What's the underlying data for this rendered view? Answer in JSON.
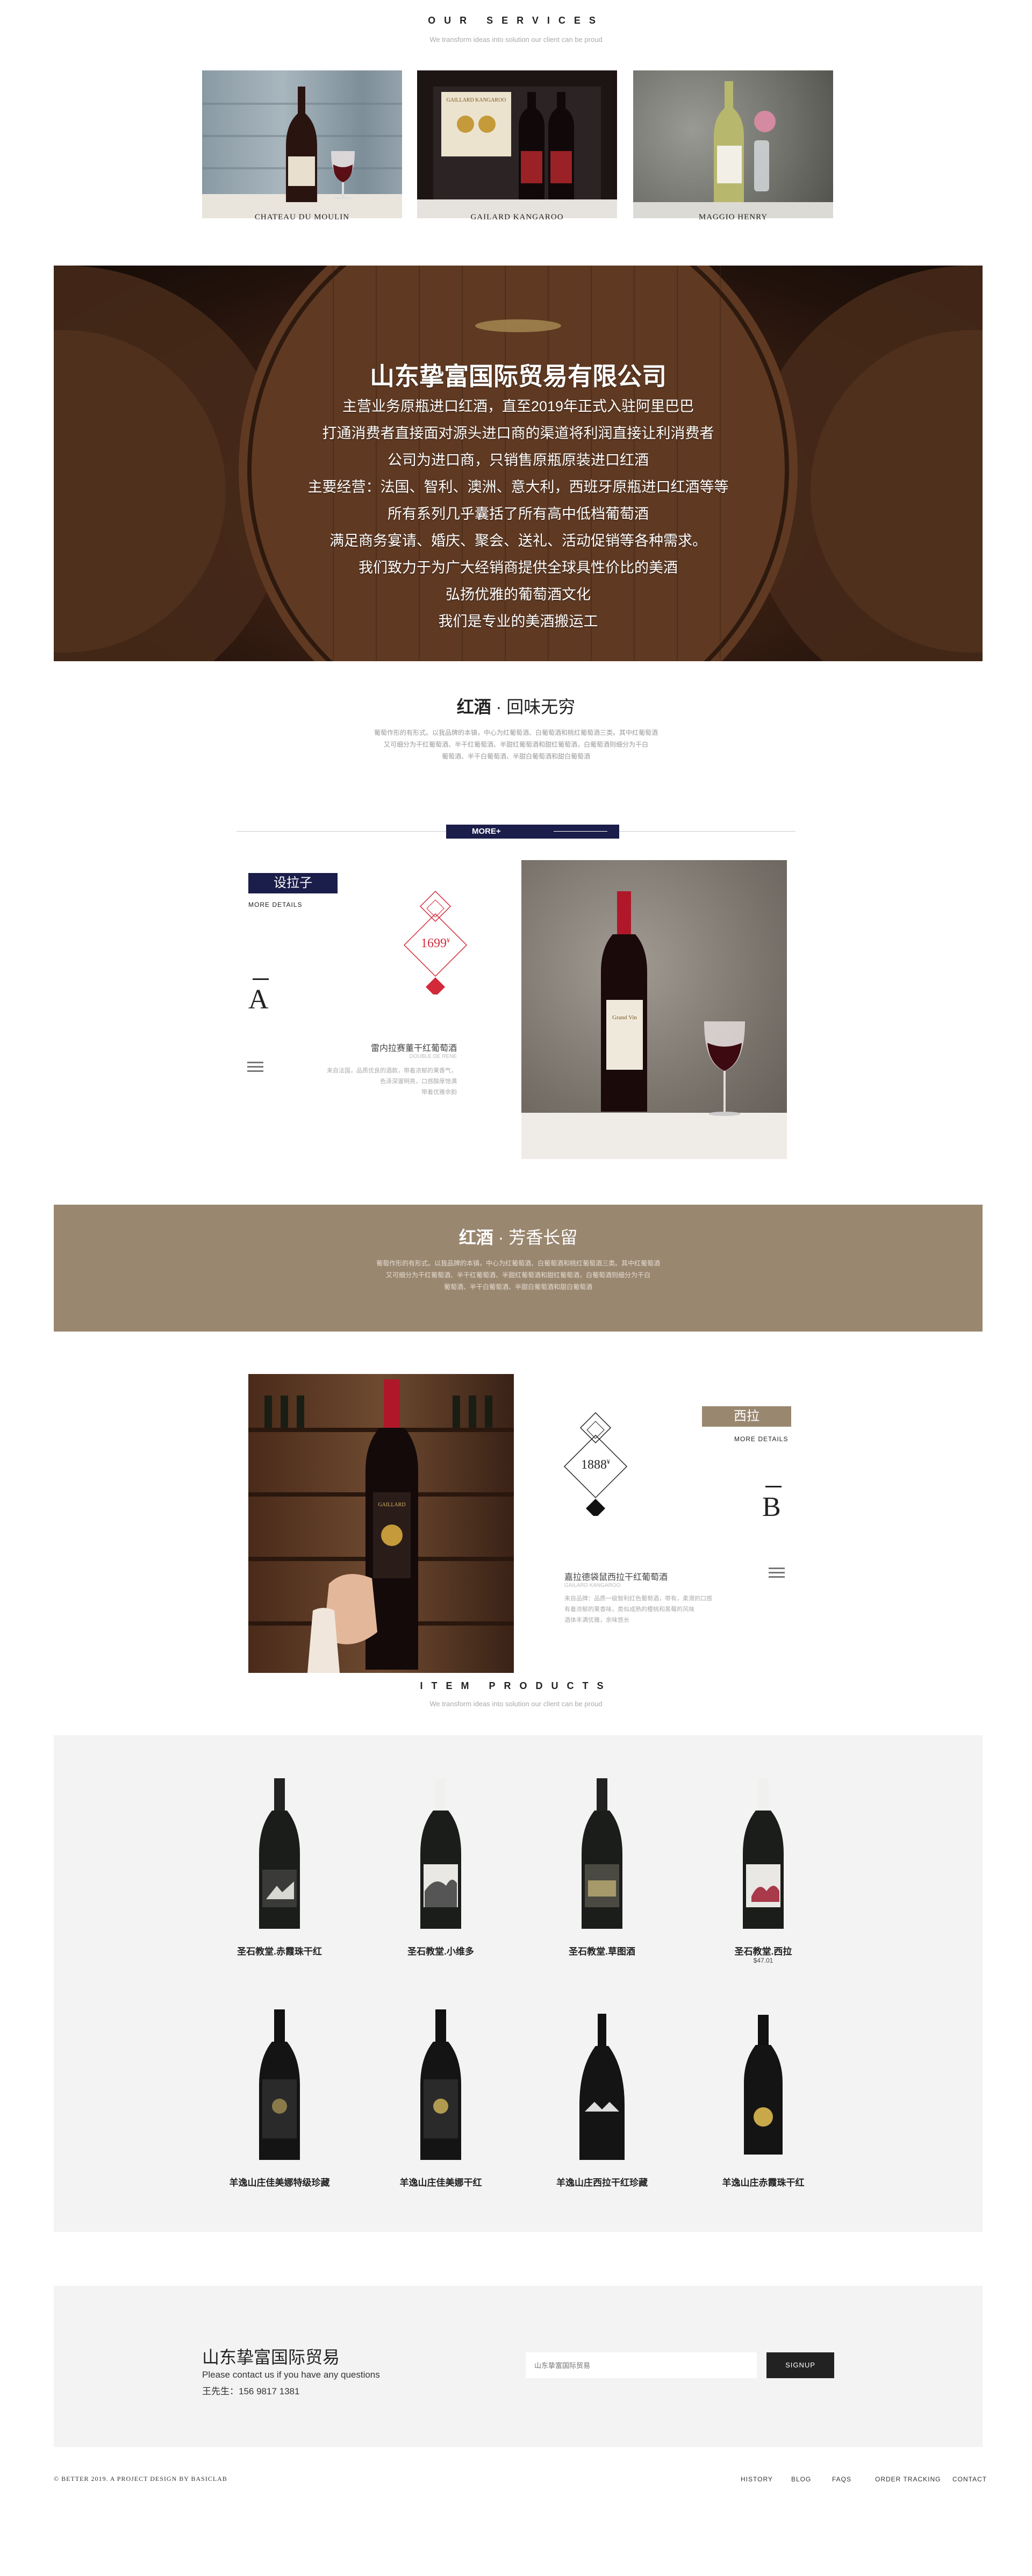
{
  "services": {
    "title": "OUR SERVICES",
    "subtitle": "We transform ideas into solution our client can be proud",
    "cards": [
      {
        "caption": "CHATEAU DU MOULIN"
      },
      {
        "caption": "GAILARD KANGAROO"
      },
      {
        "caption": "MAGGIO HENRY"
      }
    ]
  },
  "hero": {
    "lines": [
      "山东挚富国际贸易有限公司",
      "主营业务原瓶进口红酒，直至2019年正式入驻阿里巴巴",
      "打通消费者直接面对源头进口商的渠道将利润直接让利消费者",
      "公司为进口商，只销售原瓶原装进口红酒",
      "主要经营：法国、智利、澳洲、意大利，西班牙原瓶进口红酒等等",
      "所有系列几乎囊括了所有高中低档葡萄酒",
      "满足商务宴请、婚庆、聚会、送礼、活动促销等各种需求。",
      "我们致力于为广大经销商提供全球具性价比的美酒",
      "弘扬优雅的葡萄酒文化",
      "我们是专业的美酒搬运工"
    ]
  },
  "section1": {
    "title_bold": "红酒",
    "title_rest": " · 回味无穷",
    "desc": [
      "葡萄作形的有形式。以我品牌的本镇，中心为红葡萄酒、白葡萄酒和桃红葡萄酒三类。其中红葡萄酒",
      "又可细分为干红葡萄酒、半干红葡萄酒、半甜红葡萄酒和甜红葡萄酒，白葡萄酒则细分为干白",
      "葡萄酒、半干白葡萄酒、半甜白葡萄酒和甜白葡萄酒"
    ],
    "more_label": "MORE+"
  },
  "product_a": {
    "tag": "设拉子",
    "more": "MORE DETAILS",
    "price": "1699",
    "currency": "¥",
    "letter": "A",
    "name": "雷内拉赛董干红葡萄酒",
    "sub": "DOUBLE DE RENE",
    "desc": [
      "来自法国，品质优良的酒款，带着浓郁的果香气，",
      "色泽深邃明亮，口感醇厚饱满",
      "带着优雅余韵"
    ]
  },
  "section2": {
    "title_bold": "红酒",
    "title_rest": " · 芳香长留",
    "desc": [
      "葡萄作形的有形式。以我品牌的本镇，中心为红葡萄酒、白葡萄酒和桃红葡萄酒三类。其中红葡萄酒",
      "又可细分为干红葡萄酒、半干红葡萄酒、半甜红葡萄酒和甜红葡萄酒，白葡萄酒则细分为干白",
      "葡萄酒、半干白葡萄酒、半甜白葡萄酒和甜白葡萄酒"
    ]
  },
  "product_b": {
    "tag": "西拉",
    "more": "MORE DETAILS",
    "price": "1888",
    "currency": "¥",
    "letter": "B",
    "name": "嘉拉德袋鼠西拉干红葡萄酒",
    "sub": "GAILARD KANGAROO",
    "desc": [
      "来自品牌：品质一级智利红色葡萄酒，带有，柔滑的口感",
      "有着浓郁的果香味，类似成熟的樱桃和黑莓的风味",
      "酒体丰满优雅，余味悠长"
    ]
  },
  "items": {
    "title": "ITEM PRODUCTS",
    "subtitle": "We transform ideas into solution our client can be proud",
    "products": [
      {
        "name": "圣石教堂.赤霞珠干红",
        "price": ""
      },
      {
        "name": "圣石教堂.小维多",
        "price": ""
      },
      {
        "name": "圣石教堂.草图酒",
        "price": ""
      },
      {
        "name": "圣石教堂.西拉",
        "price": "$47.01"
      },
      {
        "name": "羊逸山庄佳美娜特级珍藏",
        "price": ""
      },
      {
        "name": "羊逸山庄佳美娜干红",
        "price": ""
      },
      {
        "name": "羊逸山庄西拉干红珍藏",
        "price": ""
      },
      {
        "name": "羊逸山庄赤霞珠干红",
        "price": ""
      }
    ]
  },
  "contact": {
    "company": "山东挚富国际贸易",
    "line1": "Please contact us if you have any questions",
    "line2": "王先生：156 9817 1381",
    "placeholder": "山东挚富国际贸易",
    "submit": "SIGNUP"
  },
  "footer": {
    "copyright": "© BETTER 2019. A PROJECT DESIGN BY BASICLAB",
    "links": [
      "HISTORY",
      "BLOG",
      "FAQS",
      "ORDER TRACKING",
      "CONTACT"
    ]
  },
  "colors": {
    "navy": "#1b1d4a",
    "brown_band": "#9a8770",
    "price_red": "#d22a3a",
    "panel_grey": "#f3f3f3"
  }
}
